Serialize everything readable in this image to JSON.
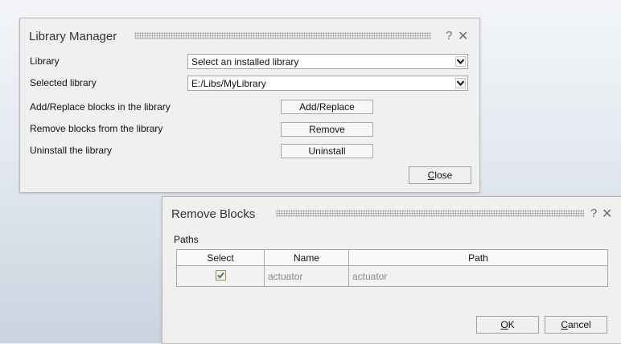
{
  "library_manager": {
    "title": "Library Manager",
    "library_label": "Library",
    "library_value": "Select an installed library",
    "selected_label": "Selected library",
    "selected_value": "E:/Libs/MyLibrary",
    "add_label": "Add/Replace blocks in the library",
    "add_button": "Add/Replace",
    "remove_label": "Remove blocks from the library",
    "remove_button": "Remove",
    "uninstall_label": "Uninstall the library",
    "uninstall_button": "Uninstall",
    "close_mnemonic": "C",
    "close_rest": "lose",
    "help_glyph": "?",
    "close_glyph": "✕"
  },
  "remove_blocks": {
    "title": "Remove Blocks",
    "paths_label": "Paths",
    "columns": [
      "Select",
      "Name",
      "Path"
    ],
    "rows": [
      {
        "selected": true,
        "name": "actuator",
        "path": "actuator"
      }
    ],
    "ok_mnemonic": "O",
    "ok_rest": "K",
    "cancel_mnemonic": "C",
    "cancel_rest": "ancel",
    "help_glyph": "?",
    "close_glyph": "✕"
  },
  "colors": {
    "dialog_bg": "#f0f0f0",
    "check_bg": "#fff4c8",
    "check_mark": "#3b6fc4"
  },
  "icons": [
    "dropdown-arrow-icon",
    "help-icon",
    "close-icon",
    "checkmark-icon"
  ]
}
